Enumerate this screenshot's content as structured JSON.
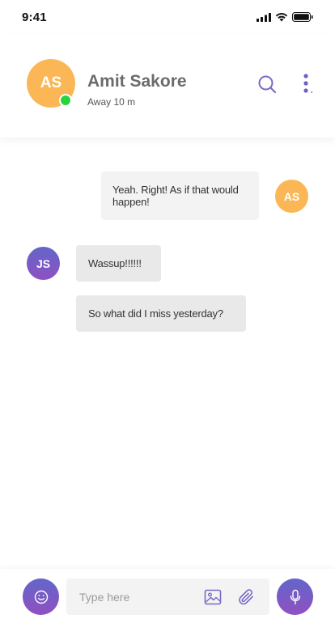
{
  "status_bar": {
    "time": "9:41"
  },
  "header": {
    "avatar_initials": "AS",
    "avatar_color": "#fbb756",
    "online_color": "#27d43f",
    "name": "Amit Sakore",
    "status": "Away 10 m",
    "icons": [
      "search-icon",
      "more-vertical-icon"
    ]
  },
  "messages": [
    {
      "from": "me",
      "avatar_initials": "AS",
      "text": "Yeah. Right! As if that would happen!"
    },
    {
      "from": "them",
      "avatar_initials": "JS",
      "text": "Wassup!!!!!!"
    },
    {
      "from": "them",
      "text": "So what did I miss yesterday?"
    }
  ],
  "composer": {
    "placeholder": "Type here",
    "value": "",
    "icons": [
      "emoji-icon",
      "image-icon",
      "paperclip-icon",
      "microphone-icon"
    ]
  },
  "colors": {
    "accent": "#7a5cc6",
    "accent_gradient_top": "#6366c9",
    "accent_gradient_bottom": "#8f50c2",
    "sent_bubble": "#f3f3f3",
    "received_bubble": "#e9e9e9"
  }
}
